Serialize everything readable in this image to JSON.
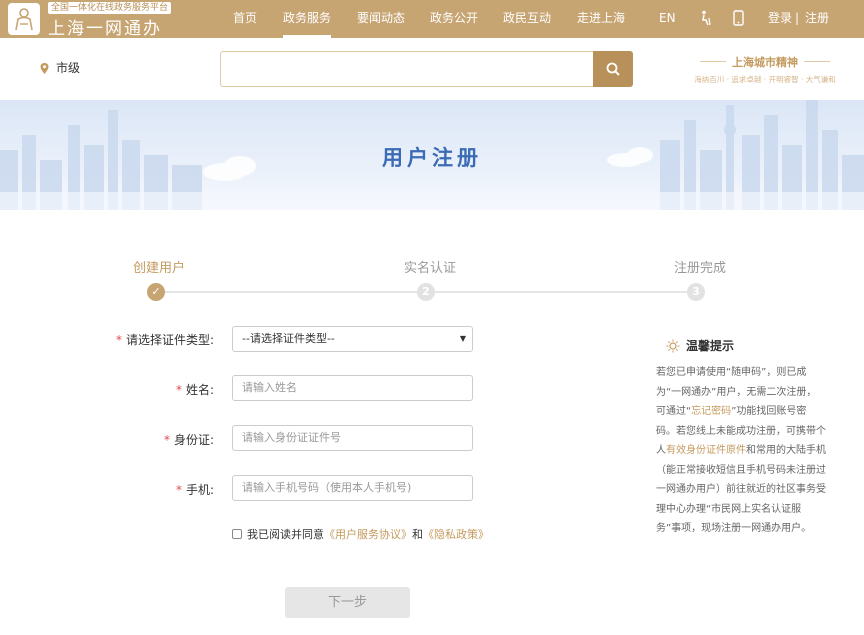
{
  "header": {
    "logo_tag": "全国一体化在线政务服务平台",
    "logo_title": "上海一网通办",
    "nav": [
      "首页",
      "政务服务",
      "要闻动态",
      "政务公开",
      "政民互动",
      "走进上海"
    ],
    "active_nav": "政务服务",
    "lang": "EN",
    "elder_icon": "elder-mode-icon",
    "mobile_icon": "mobile-icon",
    "login": "登录",
    "separator": "|",
    "register": "注册"
  },
  "location": {
    "label": "市级",
    "icon": "location-pin-icon"
  },
  "search": {
    "placeholder": "",
    "icon": "search-icon"
  },
  "slogan": {
    "title": "上海城市精神",
    "sub": "海纳百川 · 追求卓越 · 开明睿智 · 大气谦和"
  },
  "banner": {
    "title": "用户注册"
  },
  "steps": [
    {
      "label": "创建用户",
      "mark": "✓",
      "state": "active"
    },
    {
      "label": "实名认证",
      "mark": "2",
      "state": "pending"
    },
    {
      "label": "注册完成",
      "mark": "3",
      "state": "pending"
    }
  ],
  "form": {
    "id_type": {
      "required": "*",
      "label": "请选择证件类型:",
      "value": "--请选择证件类型--"
    },
    "name": {
      "required": "*",
      "label": "姓名:",
      "placeholder": "请输入姓名"
    },
    "id_number": {
      "required": "*",
      "label": "身份证:",
      "placeholder": "请输入身份证证件号"
    },
    "phone": {
      "required": "*",
      "label": "手机:",
      "placeholder": "请输入手机号码（使用本人手机号)"
    },
    "agree": {
      "prefix": "我已阅读并同意",
      "link1": "《用户服务协议》",
      "and": "和",
      "link2": "《隐私政策》"
    },
    "next_button": "下一步"
  },
  "tips": {
    "title": "温馨提示",
    "p1": "若您已申请使用“随申码”，则已成为“一网通办”用户，无需二次注册，可通过“",
    "link": "忘记密码",
    "p2": "”功能找回账号密码。若您线上未能成功注册，可携带个人",
    "highlight": "有效身份证件原件",
    "p3": "和常用的大陆手机（能正常接收短信且手机号码未注册过一网通办用户）前往就近的社区事务受理中心办理“市民网上实名认证服务”事项，现场注册一网通办用户。"
  },
  "colors": {
    "brand": "#c7a573",
    "accent_text": "#c49a5e",
    "banner_title": "#3b6bb5",
    "required": "#e34a4a"
  }
}
